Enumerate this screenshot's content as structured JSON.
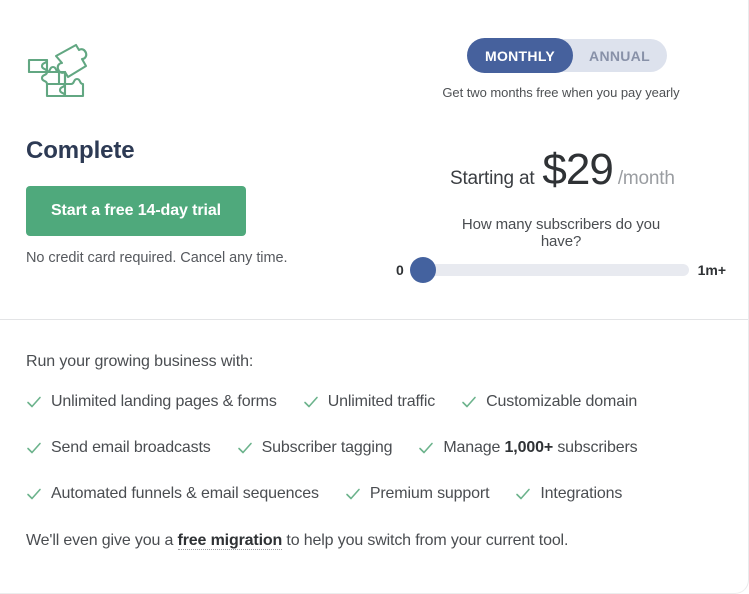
{
  "plan": {
    "icon": "puzzle-icon",
    "name": "Complete",
    "cta_label": "Start a free 14-day trial",
    "cta_note": "No credit card required. Cancel any time."
  },
  "billing": {
    "options": [
      {
        "label": "MONTHLY",
        "active": true
      },
      {
        "label": "ANNUAL",
        "active": false
      }
    ],
    "note": "Get two months free when you pay yearly"
  },
  "price": {
    "prefix": "Starting at",
    "amount": "$29",
    "period": "/month"
  },
  "slider": {
    "question": "How many subscribers do you have?",
    "min_label": "0",
    "max_label": "1m+",
    "value_percent": 0
  },
  "features": {
    "intro": "Run your growing business with:",
    "rows": [
      [
        {
          "text": "Unlimited landing pages & forms"
        },
        {
          "text": "Unlimited traffic"
        },
        {
          "text": "Customizable domain"
        }
      ],
      [
        {
          "text": "Send email broadcasts"
        },
        {
          "text": "Subscriber tagging"
        },
        {
          "pre": "Manage ",
          "bold": "1,000+",
          "post": " subscribers"
        }
      ],
      [
        {
          "text": "Automated funnels & email sequences"
        },
        {
          "text": "Premium support"
        },
        {
          "text": "Integrations"
        }
      ]
    ]
  },
  "migration": {
    "pre": "We'll even give you a ",
    "link": "free migration",
    "post": " to help you switch from your current tool."
  },
  "colors": {
    "accent_green": "#4fa97c",
    "accent_blue": "#46619d",
    "heading": "#2d3a54",
    "body_text": "#4a4d51",
    "track": "#e8eaf0",
    "toggle_bg": "#dde2ed"
  }
}
